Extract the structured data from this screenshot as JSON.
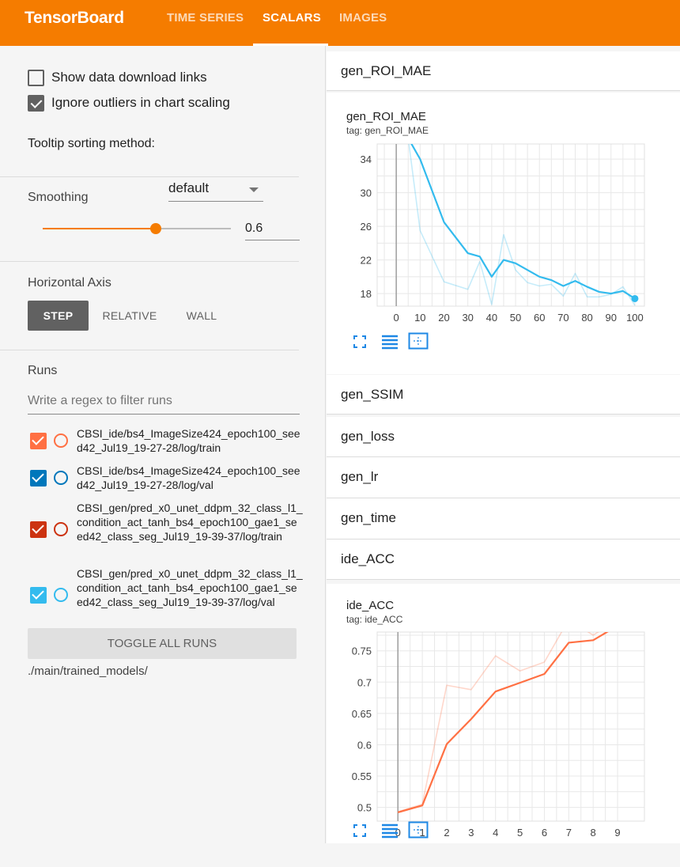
{
  "app": {
    "title": "TensorBoard",
    "brand_color": "#f57c00"
  },
  "tabs": [
    {
      "label": "TIME SERIES",
      "active": false
    },
    {
      "label": "SCALARS",
      "active": true
    },
    {
      "label": "IMAGES",
      "active": false
    }
  ],
  "settings": {
    "show_download_label": "Show data download links",
    "show_download_checked": false,
    "ignore_outliers_label": "Ignore outliers in chart scaling",
    "ignore_outliers_checked": true,
    "tooltip_label": "Tooltip sorting method:",
    "tooltip_value": "default",
    "smoothing_label": "Smoothing",
    "smoothing_value": "0.6",
    "horizontal_axis_label": "Horizontal Axis",
    "axis_options": [
      "STEP",
      "RELATIVE",
      "WALL"
    ],
    "axis_selected": "STEP"
  },
  "runs": {
    "label": "Runs",
    "filter_placeholder": "Write a regex to filter runs",
    "items": [
      {
        "name": "CBSI_ide/bs4_ImageSize424_epoch100_seed42_Jul19_19-27-28/log/train",
        "color": "#ff7043",
        "checked": true
      },
      {
        "name": "CBSI_ide/bs4_ImageSize424_epoch100_seed42_Jul19_19-27-28/log/val",
        "color": "#0077bb",
        "checked": true
      },
      {
        "name": "CBSI_gen/pred_x0_unet_ddpm_32_class_l1_condition_act_tanh_bs4_epoch100_gae1_seed42_class_seg_Jul19_19-39-37/log/train",
        "color": "#cc3311",
        "checked": true
      },
      {
        "name": "CBSI_gen/pred_x0_unet_ddpm_32_class_l1_condition_act_tanh_bs4_epoch100_gae1_seed42_class_seg_Jul19_19-39-37/log/val",
        "color": "#33bbee",
        "checked": true
      }
    ],
    "toggle_all_label": "TOGGLE ALL RUNS",
    "logdir": "./main/trained_models/"
  },
  "groups": {
    "gen_roi_mae": "gen_ROI_MAE",
    "gen_ssim": "gen_SSIM",
    "gen_loss": "gen_loss",
    "gen_lr": "gen_lr",
    "gen_time": "gen_time",
    "ide_acc": "ide_ACC"
  },
  "cards": {
    "roi_title": "gen_ROI_MAE",
    "roi_tag": "tag: gen_ROI_MAE",
    "acc_title": "ide_ACC",
    "acc_tag": "tag: ide_ACC"
  },
  "chart_data": [
    {
      "type": "line",
      "title": "gen_ROI_MAE",
      "xlabel": "",
      "ylabel": "",
      "x_ticks": [
        0,
        10,
        20,
        30,
        40,
        50,
        60,
        70,
        80,
        90,
        100
      ],
      "y_ticks": [
        18,
        22,
        26,
        30,
        34
      ],
      "xlim": [
        -8,
        104
      ],
      "ylim": [
        16.5,
        35.8
      ],
      "series": [
        {
          "color": "#33bbee",
          "smoothed": true,
          "x": [
            5,
            10,
            20,
            30,
            35,
            40,
            45,
            50,
            55,
            60,
            65,
            70,
            75,
            80,
            85,
            90,
            95,
            100
          ],
          "y": [
            36.5,
            34,
            26.5,
            22.8,
            22.4,
            20,
            22,
            21.6,
            20.8,
            20,
            19.6,
            18.9,
            19.5,
            18.8,
            18.2,
            18,
            18.3,
            17.4
          ]
        },
        {
          "color": "#33bbee",
          "smoothed": false,
          "x": [
            5,
            10,
            20,
            30,
            35,
            40,
            45,
            50,
            55,
            60,
            65,
            70,
            75,
            80,
            85,
            90,
            95,
            100
          ],
          "y": [
            36.5,
            25.5,
            19.4,
            18.5,
            21.8,
            16.7,
            25,
            20.8,
            19.3,
            18.9,
            19.1,
            17.7,
            20.4,
            17.6,
            17.6,
            17.9,
            18.8,
            16.6
          ]
        }
      ]
    },
    {
      "type": "line",
      "title": "ide_ACC",
      "xlabel": "",
      "ylabel": "",
      "x_ticks": [
        0,
        1,
        2,
        3,
        4,
        5,
        6,
        7,
        8,
        9
      ],
      "y_ticks": [
        0.5,
        0.55,
        0.6,
        0.65,
        0.7,
        0.75
      ],
      "y_tick_labels": [
        "0.5",
        "0.55",
        "0.6",
        "0.65",
        "0.7",
        "0.75"
      ],
      "xlim": [
        -0.85,
        10.1
      ],
      "ylim": [
        0.478,
        0.78
      ],
      "series": [
        {
          "color": "#ff7043",
          "smoothed": true,
          "x": [
            0,
            1,
            2,
            3,
            4,
            5,
            6,
            7,
            8,
            9
          ],
          "y": [
            0.492,
            0.503,
            0.601,
            0.641,
            0.685,
            0.699,
            0.713,
            0.763,
            0.767,
            0.79
          ]
        },
        {
          "color": "#ff7043",
          "smoothed": false,
          "x": [
            0,
            1,
            2,
            3,
            4,
            5,
            6,
            7,
            8,
            9
          ],
          "y": [
            0.493,
            0.505,
            0.695,
            0.688,
            0.742,
            0.718,
            0.732,
            0.8,
            0.775,
            0.8
          ]
        }
      ]
    }
  ]
}
